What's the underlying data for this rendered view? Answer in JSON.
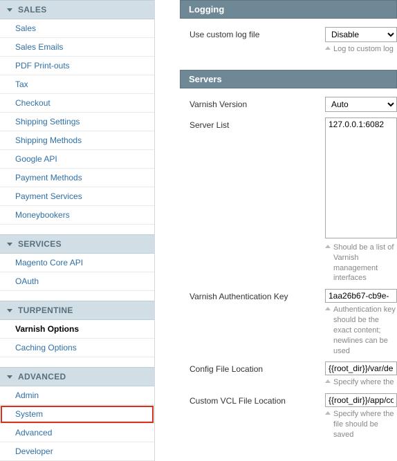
{
  "sidebar": {
    "sections": [
      {
        "title": "SALES",
        "items": [
          "Sales",
          "Sales Emails",
          "PDF Print-outs",
          "Tax",
          "Checkout",
          "Shipping Settings",
          "Shipping Methods",
          "Google API",
          "Payment Methods",
          "Payment Services",
          "Moneybookers"
        ]
      },
      {
        "title": "SERVICES",
        "items": [
          "Magento Core API",
          "OAuth"
        ]
      },
      {
        "title": "TURPENTINE",
        "items": [
          "Varnish Options",
          "Caching Options"
        ],
        "boldIndex": 0
      },
      {
        "title": "ADVANCED",
        "items": [
          "Admin",
          "System",
          "Advanced",
          "Developer"
        ],
        "highlightIndex": 1
      }
    ]
  },
  "panels": {
    "logging": {
      "title": "Logging",
      "useCustomLogFile": {
        "label": "Use custom log file",
        "value": "Disable",
        "hint": "Log to custom log"
      }
    },
    "servers": {
      "title": "Servers",
      "varnishVersion": {
        "label": "Varnish Version",
        "value": "Auto"
      },
      "serverList": {
        "label": "Server List",
        "value": "127.0.0.1:6082",
        "hint": "Should be a list of Varnish management interfaces"
      },
      "authKey": {
        "label": "Varnish Authentication Key",
        "value": "1aa26b67-cb9e-",
        "hint": "Authentication key should be the exact content; newlines can be used"
      },
      "configFile": {
        "label": "Config File Location",
        "value": "{{root_dir}}/var/de",
        "hint": "Specify where the"
      },
      "customVcl": {
        "label": "Custom VCL File Location",
        "value": "{{root_dir}}/app/co",
        "hint": "Specify where the file should be saved"
      }
    }
  }
}
